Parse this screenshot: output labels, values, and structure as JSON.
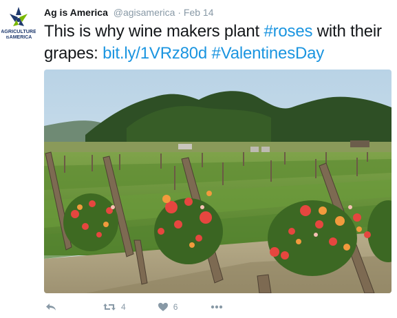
{
  "tweet": {
    "author_name": "Ag is America",
    "handle": "@agisamerica",
    "separator": "·",
    "date": "Feb 14",
    "text_prefix": "This is why wine makers plant ",
    "hashtag_roses": "#roses",
    "text_middle": " with their grapes: ",
    "url": "bit.ly/1VRz80d",
    "text_space": " ",
    "hashtag_valentines": "#ValentinesDay"
  },
  "avatar": {
    "line1": "AGRICULTURE",
    "line2": "IS",
    "line3": "AMERICA"
  },
  "actions": {
    "reply_icon": "reply-arrow-icon",
    "retweet_count": "4",
    "like_count": "6",
    "more_icon": "ellipsis-icon"
  },
  "colors": {
    "link": "#1b95e0",
    "text": "#14171a",
    "muted": "#8899a6"
  }
}
